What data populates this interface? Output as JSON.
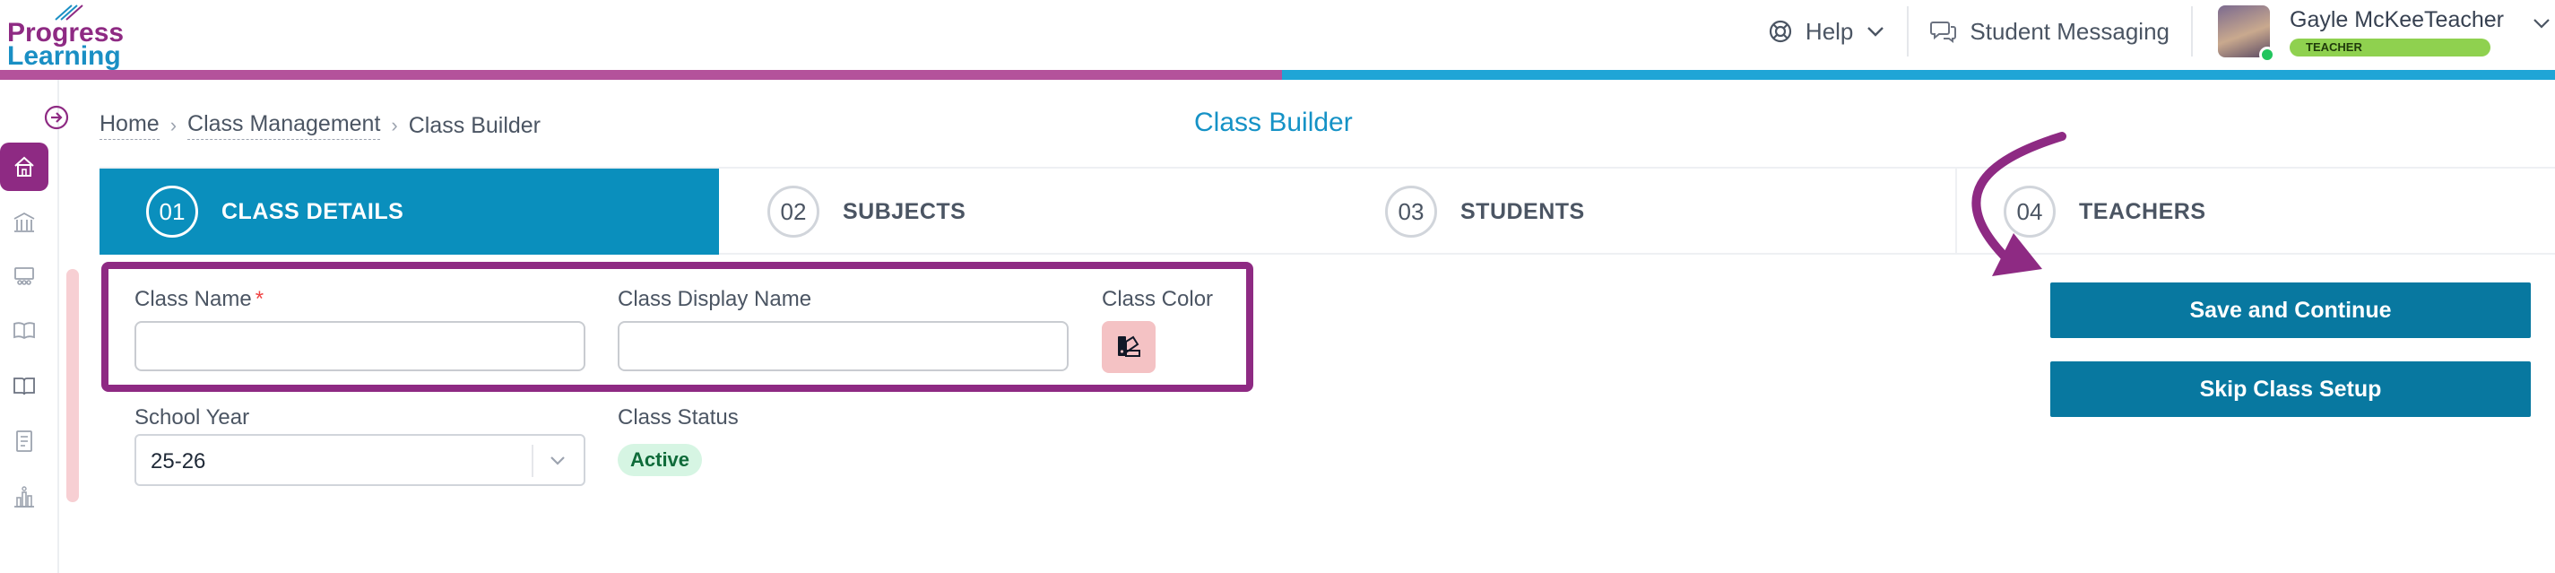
{
  "header": {
    "logo_line1": "Progress",
    "logo_line2": "Learning",
    "help_label": "Help",
    "messaging_label": "Student Messaging",
    "user_name": "Gayle McKeeTeacher",
    "user_role": "TEACHER"
  },
  "colors": {
    "brand_purple": "#8e2a83",
    "brand_blue": "#1fa5d6",
    "primary_button": "#0878a0",
    "step_active": "#0a8fbd",
    "class_color_swatch": "#f4c2c4",
    "status_active_bg": "#d6f5e3"
  },
  "sidebar": {
    "items": [
      {
        "icon": "arrow-right-circle-icon"
      },
      {
        "icon": "home-icon"
      },
      {
        "icon": "school-icon"
      },
      {
        "icon": "classroom-icon"
      },
      {
        "icon": "book-open-icon"
      },
      {
        "icon": "book-icon"
      },
      {
        "icon": "report-icon"
      },
      {
        "icon": "analytics-icon"
      }
    ]
  },
  "breadcrumb": {
    "items": [
      "Home",
      "Class Management",
      "Class Builder"
    ]
  },
  "page_title": "Class Builder",
  "steps": [
    {
      "num": "01",
      "label": "CLASS DETAILS",
      "active": true
    },
    {
      "num": "02",
      "label": "SUBJECTS",
      "active": false
    },
    {
      "num": "03",
      "label": "STUDENTS",
      "active": false
    },
    {
      "num": "04",
      "label": "TEACHERS",
      "active": false
    }
  ],
  "form": {
    "class_name_label": "Class Name",
    "required_mark": "*",
    "class_name_value": "",
    "display_name_label": "Class Display Name",
    "display_name_value": "",
    "class_color_label": "Class Color",
    "school_year_label": "School Year",
    "school_year_value": "25-26",
    "class_status_label": "Class Status",
    "class_status_value": "Active"
  },
  "actions": {
    "save_label": "Save and Continue",
    "skip_label": "Skip Class Setup"
  }
}
